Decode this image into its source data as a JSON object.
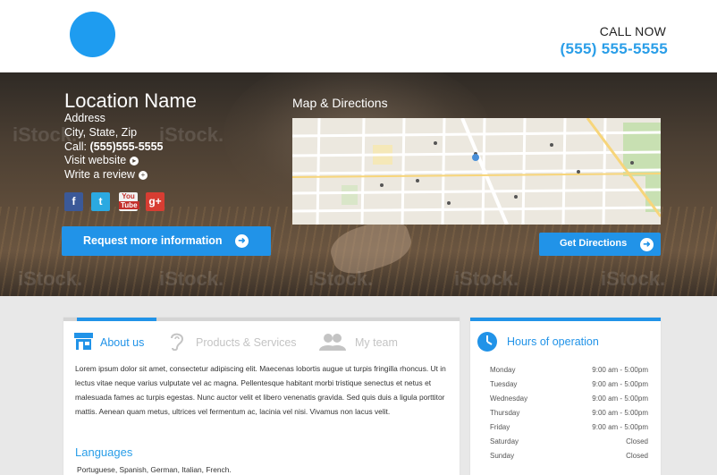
{
  "header": {
    "call_now": "CALL NOW",
    "phone": "(555) 555-5555"
  },
  "location": {
    "name": "Location Name",
    "address": "Address",
    "city_state_zip": "City, State, Zip",
    "call_label": "Call:",
    "call_number": "(555)555-5555",
    "visit_website": "Visit website",
    "write_review": "Write a review"
  },
  "social": [
    {
      "icon": "facebook-icon",
      "glyph": "f",
      "color": "#3b5998"
    },
    {
      "icon": "twitter-icon",
      "glyph": "t",
      "color": "#2ba9e1"
    },
    {
      "icon": "youtube-icon",
      "glyph": "You",
      "color": "#c4302b"
    },
    {
      "icon": "google-plus-icon",
      "glyph": "g+",
      "color": "#d73d32"
    }
  ],
  "buttons": {
    "request_info": "Request more information",
    "get_directions": "Get Directions"
  },
  "map": {
    "title": "Map & Directions"
  },
  "watermark": "iStock.",
  "tabs": [
    {
      "label": "About us",
      "icon": "store-icon",
      "active": true
    },
    {
      "label": "Products & Services",
      "icon": "ear-icon",
      "active": false
    },
    {
      "label": "My team",
      "icon": "team-icon",
      "active": false
    }
  ],
  "about": {
    "text": "Lorem ipsum dolor sit amet, consectetur adipiscing elit. Maecenas lobortis augue ut turpis fringilla rhoncus. Ut in lectus vitae neque varius vulputate vel ac magna. Pellentesque habitant morbi tristique senectus et netus et malesuada fames ac turpis egestas. Nunc auctor velit et libero venenatis gravida. Sed quis duis a ligula porttitor mattis. Aenean quam metus, ultrices vel fermentum ac, lacinia vel nisi. Vivamus non lacus velit.",
    "languages_title": "Languages",
    "languages": "Portuguese, Spanish, German, Italian, French."
  },
  "hours": {
    "title": "Hours of operation",
    "rows": [
      {
        "day": "Monday",
        "time": "9:00 am - 5:00pm"
      },
      {
        "day": "Tuesday",
        "time": "9:00 am - 5:00pm"
      },
      {
        "day": "Wednesday",
        "time": "9:00 am - 5:00pm"
      },
      {
        "day": "Thursday",
        "time": "9:00 am - 5:00pm"
      },
      {
        "day": "Friday",
        "time": "9:00 am - 5:00pm"
      },
      {
        "day": "Saturday",
        "time": "Closed"
      },
      {
        "day": "Sunday",
        "time": "Closed"
      }
    ]
  },
  "colors": {
    "accent": "#2193e8",
    "logo": "#1e9cf0"
  }
}
